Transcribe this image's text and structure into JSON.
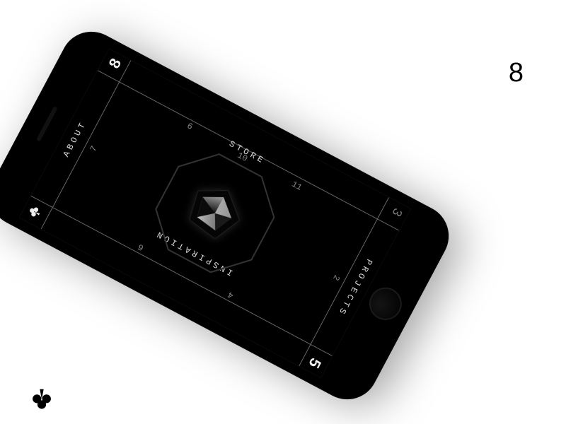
{
  "card": {
    "rank": "8",
    "suit": "clubs"
  },
  "phone_screen": {
    "nav": {
      "top": "ABOUT",
      "right": "STORE",
      "bottom": "PROJECTS",
      "left": "INSPIRATION"
    },
    "corners": {
      "top_left_icon": "clubs",
      "top_right": "8",
      "bottom_left": "5",
      "bottom_right": "3"
    },
    "ticks": {
      "top_mid": "7",
      "right_upper": "6",
      "right_mid": "10",
      "right_lower": "11",
      "bottom_mid": "2",
      "left_upper": "6",
      "left_lower": "4"
    },
    "center_graphic": "octagon-crystal"
  },
  "colors": {
    "bg": "#ffffff",
    "phone": "#000000",
    "line": "#666666",
    "text": "#dddddd"
  }
}
